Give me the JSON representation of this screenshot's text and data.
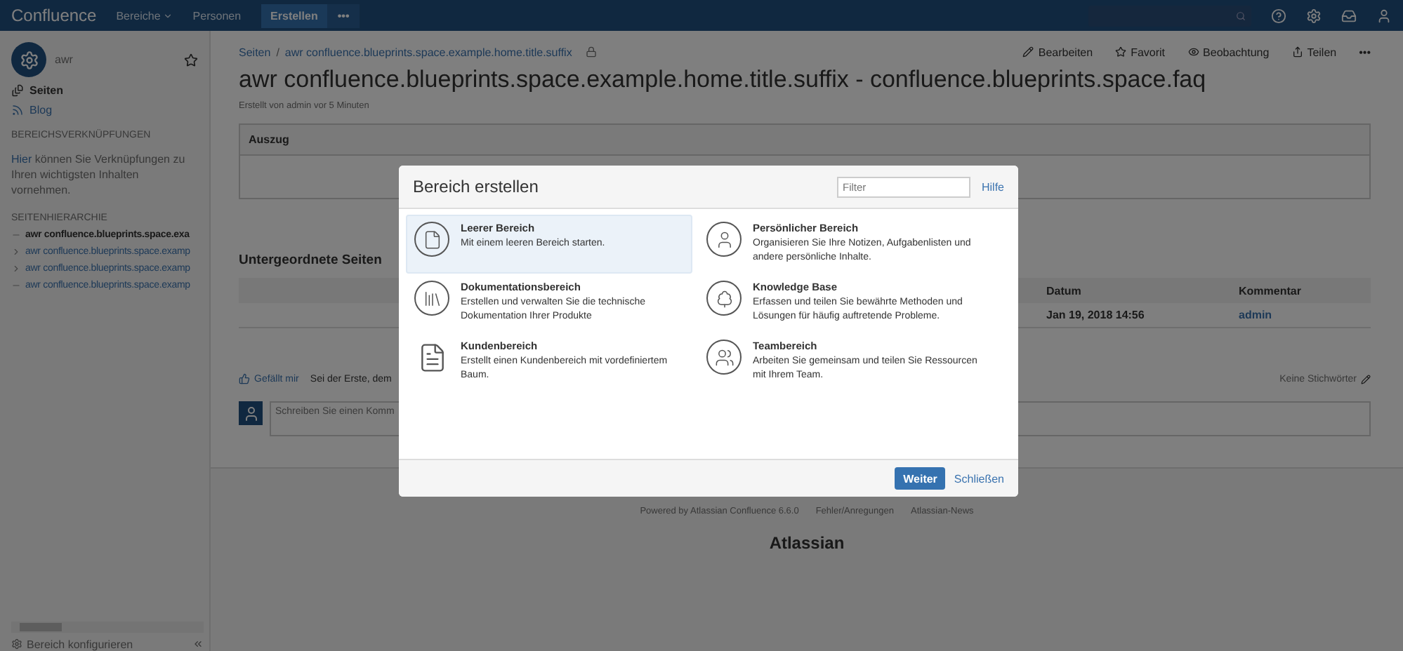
{
  "nav": {
    "logo": "Confluence",
    "items": [
      {
        "label": "Bereiche",
        "dropdown": true
      },
      {
        "label": "Personen",
        "dropdown": false
      }
    ],
    "create": "Erstellen",
    "more": "•••"
  },
  "sidebar": {
    "space_name": "awr",
    "nav": [
      {
        "label": "Seiten",
        "kind": "pages",
        "selected": true
      },
      {
        "label": "Blog",
        "kind": "blog",
        "selected": false
      }
    ],
    "shortcuts_heading": "BEREICHSVERKNÜPFUNGEN",
    "shortcuts_link": "Hier",
    "shortcuts_text": " können Sie Verknüpfungen zu Ihren wichtigsten Inhalten vornehmen.",
    "tree_heading": "SEITENHIERARCHIE",
    "tree": [
      {
        "label": "awr confluence.blueprints.space.exa",
        "selected": true,
        "expandable": false
      },
      {
        "label": "awr confluence.blueprints.space.examp",
        "selected": false,
        "expandable": true
      },
      {
        "label": "awr confluence.blueprints.space.examp",
        "selected": false,
        "expandable": true
      },
      {
        "label": "awr confluence.blueprints.space.examp",
        "selected": false,
        "expandable": false
      }
    ],
    "configure": "Bereich konfigurieren"
  },
  "page": {
    "breadcrumb": [
      "Seiten",
      "awr confluence.blueprints.space.example.home.title.suffix"
    ],
    "breadcrumb_separator": "/",
    "actions": [
      {
        "label": "Bearbeiten",
        "kind": "edit"
      },
      {
        "label": "Favorit",
        "kind": "star"
      },
      {
        "label": "Beobachtung",
        "kind": "watch"
      },
      {
        "label": "Teilen",
        "kind": "share"
      }
    ],
    "more": "•••",
    "title": "awr confluence.blueprints.space.example.home.title.suffix - confluence.blueprints.space.faq",
    "byline": "Erstellt von admin vor 5 Minuten",
    "excerpt_heading": "Auszug",
    "children_heading": "Untergeordnete Seiten",
    "table": {
      "columns": [
        "Datum",
        "Kommentar"
      ],
      "rows": [
        [
          "Jan 19, 2018 14:56",
          "admin"
        ]
      ]
    },
    "like": "Gefällt mir",
    "like_text": "Sei der Erste, dem",
    "labels": "Keine Stichwörter",
    "comment_placeholder": "Schreiben Sie einen Komm"
  },
  "footer": {
    "links": [
      "Powered by Atlassian Confluence 6.6.0",
      "Fehler/Anregungen",
      "Atlassian-News"
    ],
    "logo": "Atlassian"
  },
  "dialog": {
    "title": "Bereich erstellen",
    "filter_placeholder": "Filter",
    "help": "Hilfe",
    "items": [
      {
        "title": "Leerer Bereich",
        "text": "Mit einem leeren Bereich starten.",
        "kind": "blank",
        "selected": true
      },
      {
        "title": "Persönlicher Bereich",
        "text": "Organisieren Sie Ihre Notizen, Aufgabenlisten und andere persönliche Inhalte.",
        "kind": "personal",
        "selected": false
      },
      {
        "title": "Dokumentationsbereich",
        "text": "Erstellen und verwalten Sie die technische Dokumentation Ihrer Produkte",
        "kind": "docs",
        "selected": false
      },
      {
        "title": "Knowledge Base",
        "text": "Erfassen und teilen Sie bewährte Methoden und Lösungen für häufig auftretende Probleme.",
        "kind": "kb",
        "selected": false
      },
      {
        "title": "Kundenbereich",
        "text": "Erstellt einen Kundenbereich mit vordefiniertem Baum.",
        "kind": "customer",
        "selected": false
      },
      {
        "title": "Teambereich",
        "text": "Arbeiten Sie gemeinsam und teilen Sie Ressourcen mit Ihrem Team.",
        "kind": "team",
        "selected": false
      }
    ],
    "primary": "Weiter",
    "close": "Schließen"
  }
}
